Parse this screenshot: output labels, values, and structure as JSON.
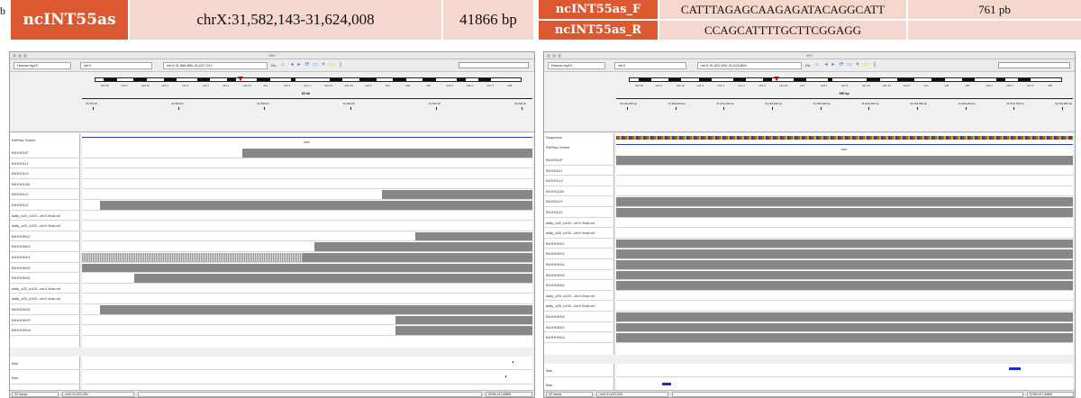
{
  "left_header": {
    "name": "ncINT55as",
    "coords": "chrX:31,582,143-31,624,008",
    "size": "41866 bp"
  },
  "right_header": {
    "primer_f_name": "ncINT55as_F",
    "primer_r_name": "ncINT55as_R",
    "primer_f_seq": "CATTTAGAGCAAGAGATACAGGCATT",
    "primer_r_seq": "CCAGCATTTTGCTTCGGAGG",
    "product": "761 pb"
  },
  "panel_letter": "b",
  "colors": {
    "banner_dark": "#dc5830",
    "banner_light": "#f6d7cd",
    "coverage_gray": "#878787",
    "gene_blue": "#2f3fb4",
    "feature_blue": "#1f2cc8",
    "locus_red": "#dd0000"
  },
  "left_igv": {
    "window_title": "IGV",
    "genome": "Human hg19",
    "chromosome": "chrX",
    "locus": "chrX:31,566,854-31,627,247",
    "go_label": "Go",
    "span_label": "60 kb",
    "tick_labels": [
      "31,570 kb",
      "31,580 kb",
      "31,590 kb",
      "31,600 kb",
      "31,610 kb",
      "31,620 kb"
    ],
    "ideogram_bands": [
      "p22.32",
      "p22.2",
      "p22.12",
      "p21.3",
      "p21.1",
      "p11.4",
      "p11.3",
      "p11.23",
      "q12",
      "q13.1",
      "q21.1",
      "q21.31",
      "q21.33",
      "q22.2",
      "q23",
      "q24",
      "q25",
      "q26.1",
      "q26.3",
      "q27.2",
      "q28"
    ],
    "refseq_label": "RefSeq Genes",
    "gene_label": "DMD",
    "tracks": [
      {
        "name": "BIOHOLIF",
        "coverage": [
          0.355,
          1.0
        ]
      },
      {
        "name": "BIOHOLIJ",
        "coverage": []
      },
      {
        "name": "BIOHOLIV",
        "coverage": []
      },
      {
        "name": "BIOHOLIW",
        "coverage": []
      },
      {
        "name": "BIOHOLIY",
        "coverage": [
          0.665,
          1.0
        ]
      },
      {
        "name": "BIOHOLIZ",
        "coverage": [
          0.04,
          1.0
        ]
      },
      {
        "name": "daily_s20_s100...chrX.final.vcf",
        "coverage": []
      },
      {
        "name": "daily_s20_s100...chrX.final.vcf",
        "coverage": []
      },
      {
        "name": "BIOHOKK2",
        "coverage": [
          0.74,
          1.0
        ]
      },
      {
        "name": "BIOHOKK3",
        "coverage": [
          0.515,
          1.0
        ]
      },
      {
        "name": "BIOHOKK4",
        "coverage": [
          0.49,
          1.0
        ],
        "hatched_to": 0.49
      },
      {
        "name": "BIOHOKK5",
        "coverage": [
          0.0,
          1.0
        ]
      },
      {
        "name": "BIOHOKK6",
        "coverage": [
          0.115,
          1.0
        ]
      },
      {
        "name": "daily_s20_s100...chrX.final.vcf",
        "coverage": []
      },
      {
        "name": "daily_s20_s100...chrX.final.vcf",
        "coverage": []
      },
      {
        "name": "BIOHOKK8",
        "coverage": [
          0.04,
          1.0
        ]
      },
      {
        "name": "BIOHOKK9",
        "coverage": [
          0.695,
          1.0
        ]
      },
      {
        "name": "BIOHOKKA",
        "coverage": [
          0.695,
          1.0
        ]
      }
    ],
    "bottom_tracks": [
      "Bari",
      "Bari"
    ],
    "status_tracks": "32 tracks",
    "status_locus": "chrX:31,623,284",
    "status_memory": "603M of 1,868M"
  },
  "right_igv": {
    "window_title": "IGV",
    "genome": "Human hg19",
    "chromosome": "chrX",
    "locus": "chrX:31,622,904-31,623,859",
    "go_label": "Go",
    "span_label": "950 bp",
    "tick_labels": [
      "31,622,900 bp",
      "31,623,000 bp",
      "31,623,100 bp",
      "31,623,200 bp",
      "31,623,300 bp",
      "31,623,400 bp",
      "31,623,500 bp",
      "31,623,600 bp",
      "31,623,700 bp",
      "31,623,800 bp"
    ],
    "ideogram_bands": [
      "p22.32",
      "p22.2",
      "p22.12",
      "p21.3",
      "p21.1",
      "p11.4",
      "p11.3",
      "p11.23",
      "q12",
      "q13.1",
      "q21.1",
      "q21.31",
      "q21.33",
      "q22.2",
      "q23",
      "q24",
      "q25",
      "q26.1",
      "q26.3",
      "q27.2",
      "q28"
    ],
    "sequence_label": "Sequence",
    "refseq_label": "RefSeq Genes",
    "gene_label": "DMD",
    "tracks": [
      {
        "name": "BIOHOLIF",
        "coverage": [
          0.0,
          1.0
        ]
      },
      {
        "name": "BIOHOLIJ",
        "coverage": []
      },
      {
        "name": "BIOHOLIV",
        "coverage": []
      },
      {
        "name": "BIOHOLIW",
        "coverage": []
      },
      {
        "name": "BIOHOLIY",
        "coverage": [
          0.0,
          1.0
        ]
      },
      {
        "name": "BIOHOLIZ",
        "coverage": [
          0.0,
          1.0
        ]
      },
      {
        "name": "daily_s20_s100...chrX.final.vcf",
        "coverage": []
      },
      {
        "name": "daily_s20_s100...chrX.final.vcf",
        "coverage": []
      },
      {
        "name": "BIOHOKK2",
        "coverage": [
          0.0,
          1.0
        ]
      },
      {
        "name": "BIOHOKK3",
        "coverage": [
          0.0,
          1.0
        ]
      },
      {
        "name": "BIOHOKK4",
        "coverage": [
          0.0,
          1.0
        ]
      },
      {
        "name": "BIOHOKK5",
        "coverage": [
          0.0,
          1.0
        ]
      },
      {
        "name": "BIOHOKK6",
        "coverage": [
          0.0,
          1.0
        ]
      },
      {
        "name": "daily_s20_s100...chrX.final.vcf",
        "coverage": []
      },
      {
        "name": "daily_s20_s100...chrX.final.vcf",
        "coverage": []
      },
      {
        "name": "BIOHOKK8",
        "coverage": [
          0.0,
          1.0
        ]
      },
      {
        "name": "BIOHOKK9",
        "coverage": [
          0.0,
          1.0
        ]
      },
      {
        "name": "BIOHOKKA",
        "coverage": [
          0.0,
          1.0
        ]
      }
    ],
    "bottom_tracks": [
      "Bari",
      "Bari"
    ],
    "status_tracks": "32 tracks",
    "status_locus": "chrX:31,623,028",
    "status_memory": "578M of 1,868M"
  }
}
